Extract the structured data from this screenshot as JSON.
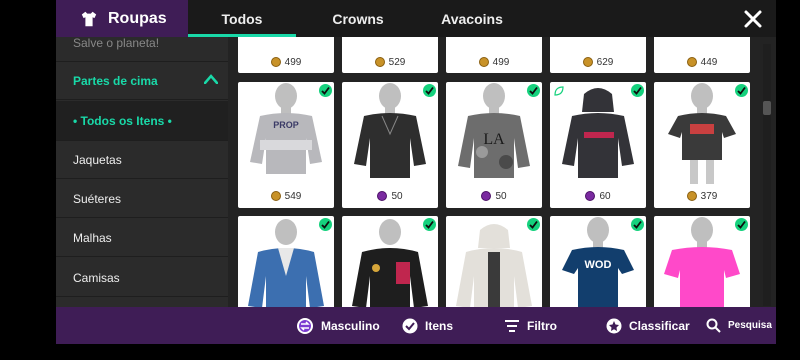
{
  "header": {
    "title": "Roupas",
    "tabs": [
      {
        "label": "Todos",
        "active": true
      },
      {
        "label": "Crowns",
        "active": false
      },
      {
        "label": "Avacoins",
        "active": false
      }
    ]
  },
  "sidebar": {
    "items": [
      {
        "label": "Salve o planeta!"
      },
      {
        "label": "Partes de cima"
      },
      {
        "label": "•  Todos os Itens  •"
      },
      {
        "label": "Jaquetas"
      },
      {
        "label": "Suéteres"
      },
      {
        "label": "Malhas"
      },
      {
        "label": "Camisas"
      }
    ]
  },
  "items_row0": [
    {
      "price": "499",
      "currency": "avacoins"
    },
    {
      "price": "529",
      "currency": "avacoins"
    },
    {
      "price": "499",
      "currency": "avacoins"
    },
    {
      "price": "629",
      "currency": "avacoins"
    },
    {
      "price": "449",
      "currency": "avacoins"
    }
  ],
  "items_row1": [
    {
      "price": "549",
      "currency": "avacoins",
      "shirt_color": "#b8b8bc",
      "graphic": "PROP"
    },
    {
      "price": "50",
      "currency": "crowns",
      "shirt_color": "#2e2e2e",
      "graphic": ""
    },
    {
      "price": "50",
      "currency": "crowns",
      "shirt_color": "#6d6d6d",
      "graphic": "LA"
    },
    {
      "price": "60",
      "currency": "crowns",
      "shirt_color": "#333338",
      "graphic": ""
    },
    {
      "price": "379",
      "currency": "avacoins",
      "shirt_color": "#3a3a3a",
      "graphic": ""
    }
  ],
  "items_row2": [
    {
      "shirt_color": "#3c6fb0",
      "graphic": ""
    },
    {
      "shirt_color": "#1e1e1e",
      "graphic": ""
    },
    {
      "shirt_color": "#e3e0da",
      "graphic": ""
    },
    {
      "shirt_color": "#123e6d",
      "graphic": "WOD"
    },
    {
      "shirt_color": "#ff49c9",
      "graphic": ""
    }
  ],
  "bottombar": {
    "masculino": "Masculino",
    "itens": "Itens",
    "filtro": "Filtro",
    "classificar": "Classificar",
    "pesquisa": "Pesquisa"
  },
  "colors": {
    "accent": "#19d9a8",
    "purple": "#3f1d56",
    "check": "#15d17d"
  }
}
